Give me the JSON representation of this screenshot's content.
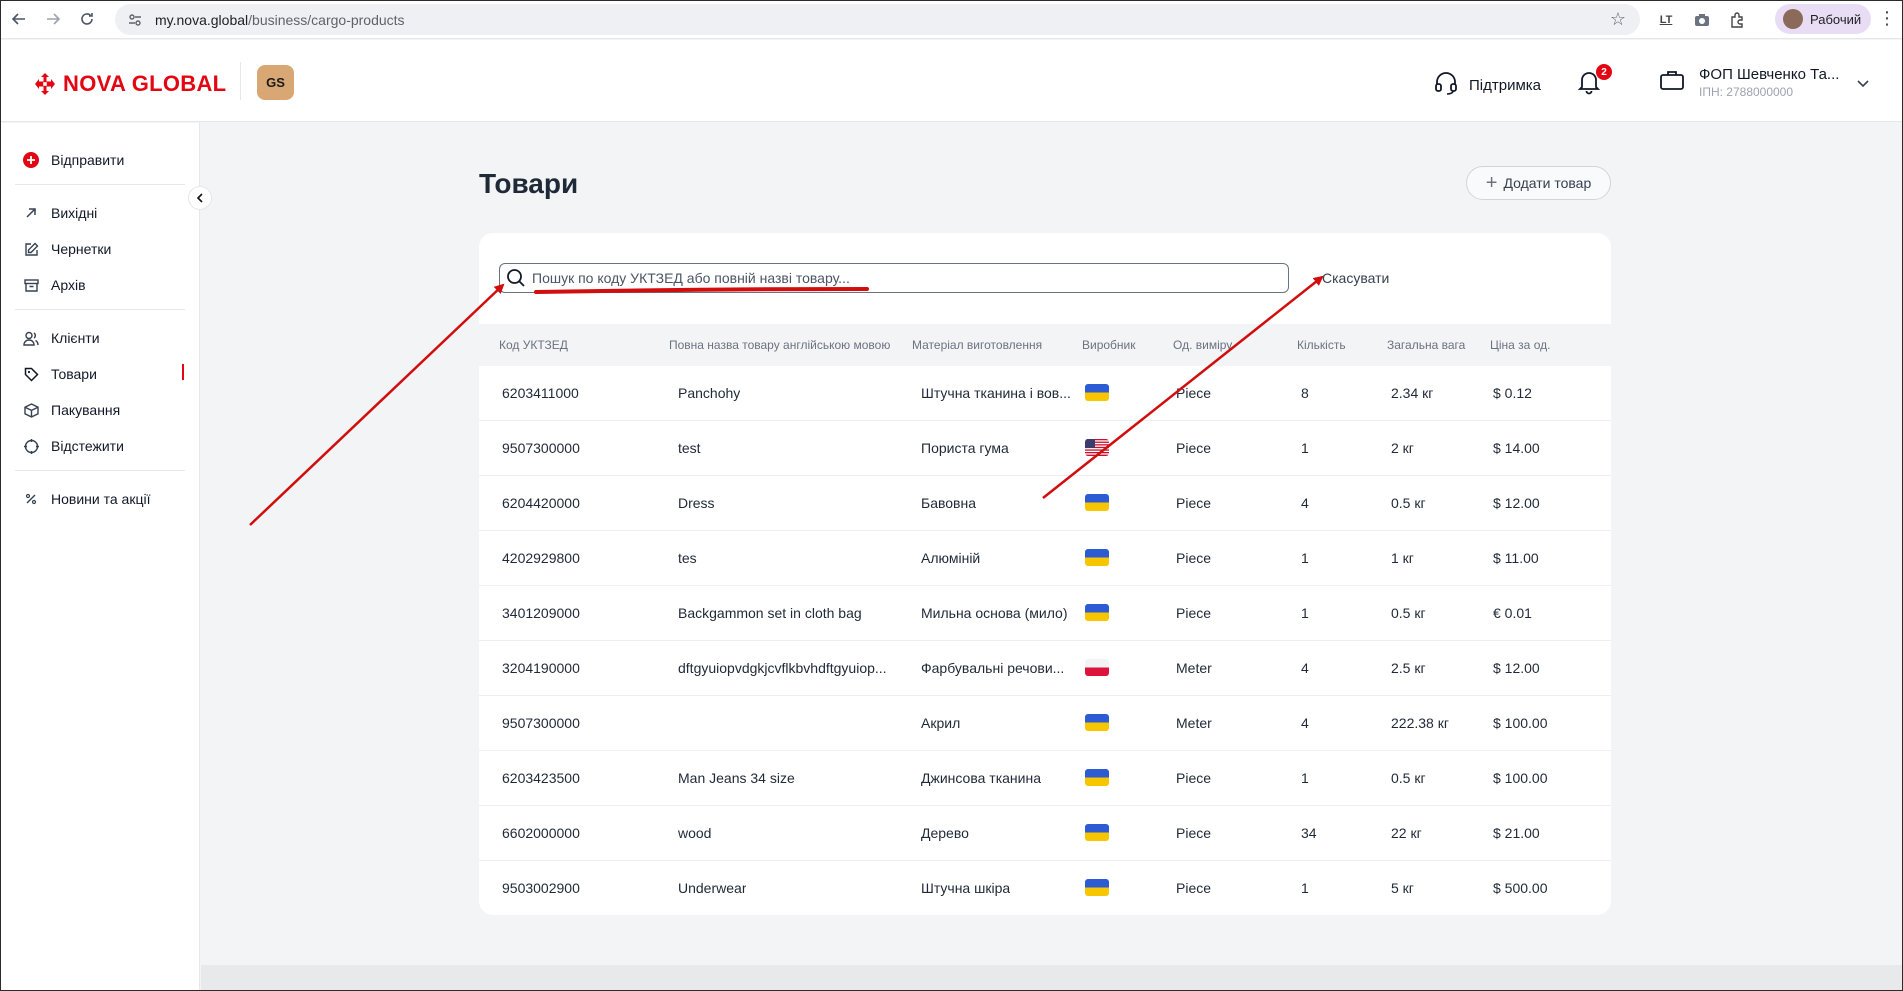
{
  "browser": {
    "url_host": "my.nova.global",
    "url_path": "/business/cargo-products",
    "profile_label": "Рабочий",
    "ext_lt": "LT"
  },
  "header": {
    "logo_text": "NOVA GLOBAL",
    "badge_text": "GS",
    "support_label": "Підтримка",
    "notifications_count": "2",
    "account_name": "ФОП Шевченко Та...",
    "account_inn": "ІПН: 2788000000"
  },
  "sidebar": {
    "send": "Відправити",
    "outgoing": "Вихідні",
    "drafts": "Чернетки",
    "archive": "Архів",
    "clients": "Клієнти",
    "products": "Товари",
    "packaging": "Пакування",
    "track": "Відстежити",
    "news": "Новини та акції"
  },
  "main": {
    "title": "Товари",
    "add_button": "Додати товар",
    "search_placeholder": "Пошук по коду УКТЗЕД або повній назві товару...",
    "cancel": "Скасувати"
  },
  "table": {
    "headers": {
      "code": "Код УКТЗЕД",
      "name": "Повна назва товару англійською мовою",
      "material": "Матеріал виготовлення",
      "maker": "Виробник",
      "unit": "Од. виміру",
      "qty": "Кількість",
      "weight": "Загальна вага",
      "price": "Ціна за од."
    },
    "rows": [
      {
        "code": "6203411000",
        "name": "Panchohy",
        "material": "Штучна тканина і вов...",
        "flag": "ua",
        "unit": "Piece",
        "qty": "8",
        "weight": "2.34 кг",
        "price": "$ 0.12"
      },
      {
        "code": "9507300000",
        "name": "test",
        "material": "Пориста гума",
        "flag": "us",
        "unit": "Piece",
        "qty": "1",
        "weight": "2 кг",
        "price": "$ 14.00"
      },
      {
        "code": "6204420000",
        "name": "Dress",
        "material": "Бавовна",
        "flag": "ua",
        "unit": "Piece",
        "qty": "4",
        "weight": "0.5 кг",
        "price": "$ 12.00"
      },
      {
        "code": "4202929800",
        "name": "tes",
        "material": "Алюміній",
        "flag": "ua",
        "unit": "Piece",
        "qty": "1",
        "weight": "1 кг",
        "price": "$ 11.00"
      },
      {
        "code": "3401209000",
        "name": "Backgammon set in cloth bag",
        "material": "Мильна основа (мило)",
        "flag": "ua",
        "unit": "Piece",
        "qty": "1",
        "weight": "0.5 кг",
        "price": "€ 0.01"
      },
      {
        "code": "3204190000",
        "name": "dftgyuiopvdgkjcvflkbvhdftgyuiop...",
        "material": "Фарбувальні речови...",
        "flag": "pl",
        "unit": "Meter",
        "qty": "4",
        "weight": "2.5 кг",
        "price": "$ 12.00"
      },
      {
        "code": "9507300000",
        "name": "",
        "material": "Акрил",
        "flag": "ua",
        "unit": "Meter",
        "qty": "4",
        "weight": "222.38 кг",
        "price": "$ 100.00"
      },
      {
        "code": "6203423500",
        "name": "Man Jeans 34 size",
        "material": "Джинсова тканина",
        "flag": "ua",
        "unit": "Piece",
        "qty": "1",
        "weight": "0.5 кг",
        "price": "$ 100.00"
      },
      {
        "code": "6602000000",
        "name": "wood",
        "material": "Дерево",
        "flag": "ua",
        "unit": "Piece",
        "qty": "34",
        "weight": "22 кг",
        "price": "$ 21.00"
      },
      {
        "code": "9503002900",
        "name": "Underwear",
        "material": "Штучна шкіра",
        "flag": "ua",
        "unit": "Piece",
        "qty": "1",
        "weight": "5 кг",
        "price": "$ 500.00"
      }
    ]
  },
  "colors": {
    "brand_red": "#e30613",
    "annotation_red": "#d10d0d"
  }
}
